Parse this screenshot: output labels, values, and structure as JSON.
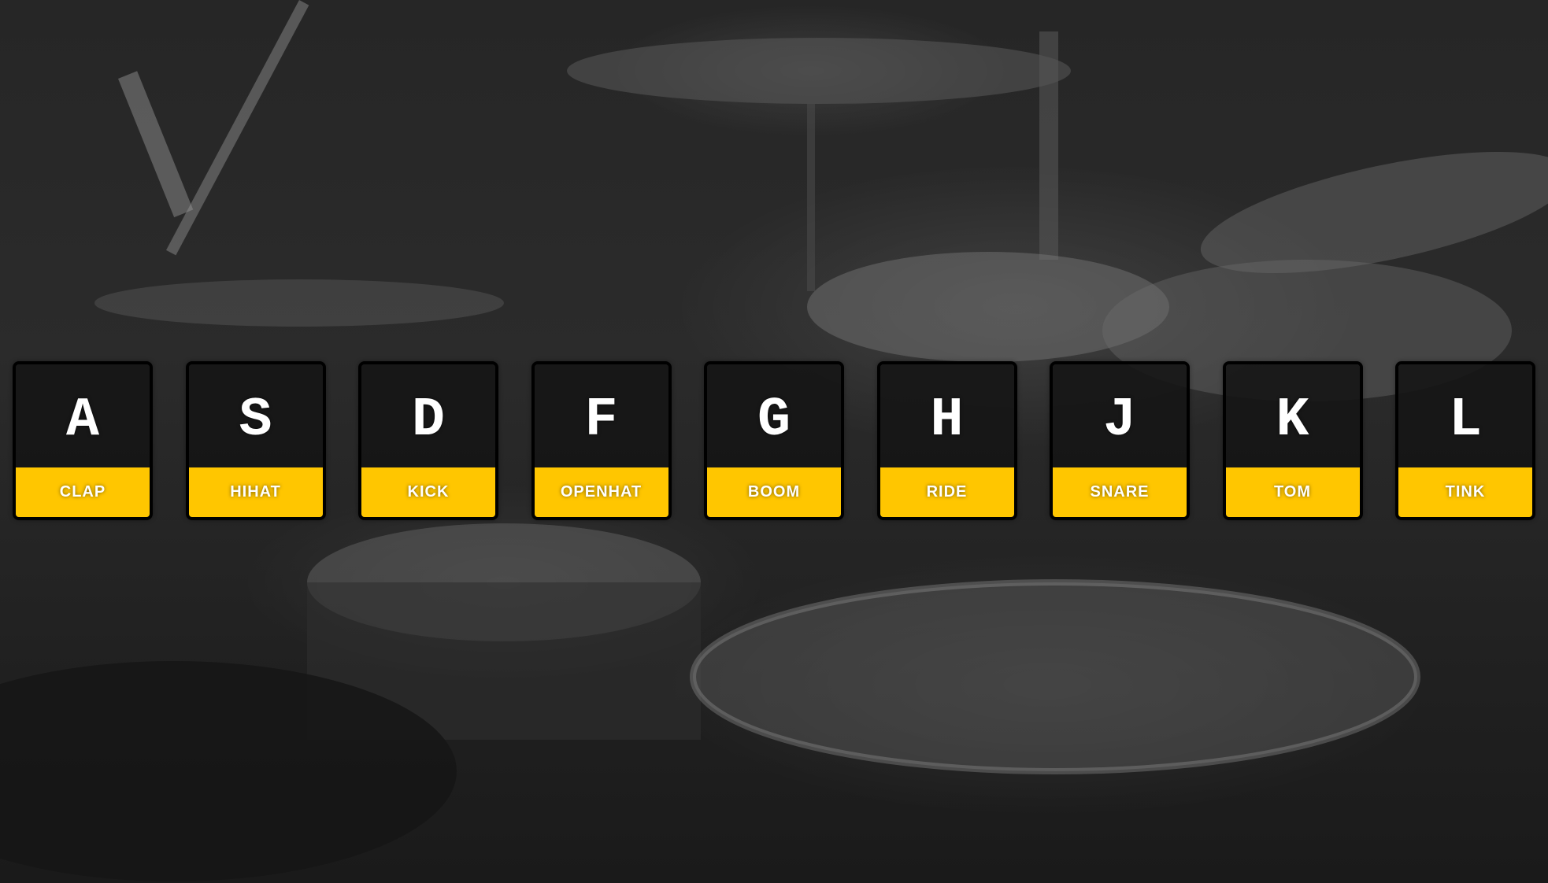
{
  "keys": [
    {
      "letter": "A",
      "sound": "CLAP"
    },
    {
      "letter": "S",
      "sound": "HIHAT"
    },
    {
      "letter": "D",
      "sound": "KICK"
    },
    {
      "letter": "F",
      "sound": "OPENHAT"
    },
    {
      "letter": "G",
      "sound": "BOOM"
    },
    {
      "letter": "H",
      "sound": "RIDE"
    },
    {
      "letter": "J",
      "sound": "SNARE"
    },
    {
      "letter": "K",
      "sound": "TOM"
    },
    {
      "letter": "L",
      "sound": "TINK"
    }
  ],
  "colors": {
    "label_background": "#ffc600",
    "key_background": "#141414",
    "key_border": "#000000",
    "text": "#ffffff"
  }
}
